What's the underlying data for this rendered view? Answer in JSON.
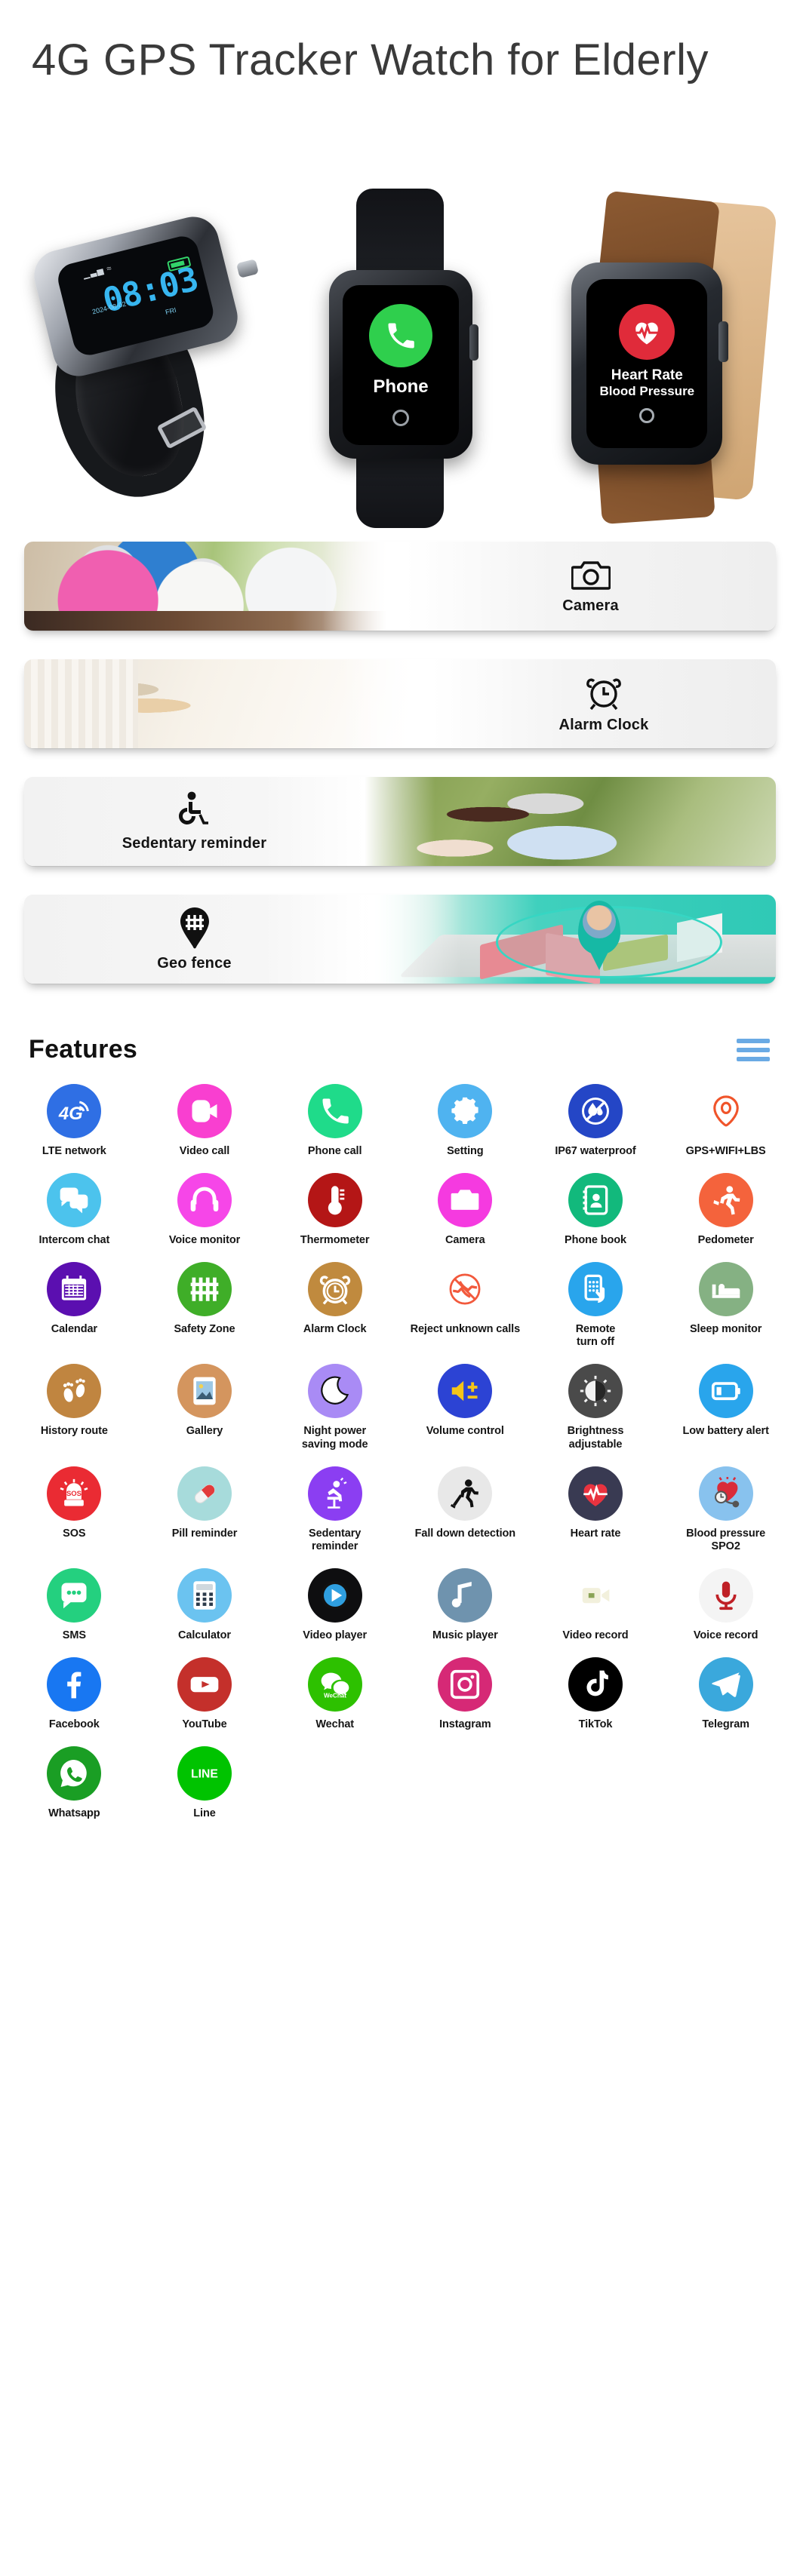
{
  "hero": {
    "title": "4G GPS Tracker Watch for Elderly",
    "watch1": {
      "time": "08:03",
      "date": "2024-08-02",
      "day": "FRI",
      "signal_icon": "signal-bars-icon",
      "wifi_icon": "wifi-icon",
      "battery_icon": "battery-icon"
    },
    "watch2": {
      "label": "Phone",
      "icon": "phone-handset-icon"
    },
    "watch3": {
      "line1": "Heart Rate",
      "line2": "Blood Pressure",
      "icon": "heart-pulse-icon"
    }
  },
  "banners": [
    {
      "label": "Camera",
      "icon": "camera-icon",
      "photo": "elderly-group-photo",
      "photo_side": "left"
    },
    {
      "label": "Alarm Clock",
      "icon": "alarm-clock-icon",
      "photo": "sleeping-woman-photo",
      "photo_side": "left"
    },
    {
      "label": "Sedentary reminder",
      "icon": "wheelchair-icon",
      "photo": "couple-outdoors-photo",
      "photo_side": "right"
    },
    {
      "label": "Geo fence",
      "icon": "geo-fence-pin-icon",
      "photo": "geo-fence-map",
      "photo_side": "right"
    }
  ],
  "features": {
    "title": "Features",
    "menu_icon": "hamburger-menu-icon",
    "menu_color": "#6aaae4",
    "items": [
      {
        "label": "LTE network",
        "icon": "4g-signal-icon",
        "color": "#2f6fe4",
        "fill": "#ffffff"
      },
      {
        "label": "Video call",
        "icon": "video-call-icon",
        "color": "#f93fd0",
        "fill": "#ffffff"
      },
      {
        "label": "Phone call",
        "icon": "phone-call-icon",
        "color": "#1fdb8a",
        "fill": "#ffffff"
      },
      {
        "label": "Setting",
        "icon": "gear-icon",
        "color": "#4fb3f0",
        "fill": "#ffffff"
      },
      {
        "label": "IP67 waterproof",
        "icon": "waterproof-drop-icon",
        "color": "#2446c6",
        "fill": "#ffffff"
      },
      {
        "label": "GPS+WIFI+LBS",
        "icon": "location-pin-icon",
        "color": "#ffffff",
        "fill": "#f0542a"
      },
      {
        "label": "Intercom chat",
        "icon": "chat-bubbles-icon",
        "color": "#4cc3ed",
        "fill": "#ffffff"
      },
      {
        "label": "Voice monitor",
        "icon": "headphones-icon",
        "color": "#f646e8",
        "fill": "#ffffff"
      },
      {
        "label": "Thermometer",
        "icon": "thermometer-icon",
        "color": "#b41616",
        "fill": "#ffffff"
      },
      {
        "label": "Camera",
        "icon": "camera-icon",
        "color": "#f53ae0",
        "fill": "#ffffff"
      },
      {
        "label": "Phone book",
        "icon": "phone-book-icon",
        "color": "#12b97c",
        "fill": "#ffffff"
      },
      {
        "label": "Pedometer",
        "icon": "running-person-icon",
        "color": "#f4633c",
        "fill": "#ffffff"
      },
      {
        "label": "Calendar",
        "icon": "calendar-icon",
        "color": "#5b0fb0",
        "fill": "#ffffff"
      },
      {
        "label": "Safety Zone",
        "icon": "fence-icon",
        "color": "#3fae28",
        "fill": "#ffffff"
      },
      {
        "label": "Alarm Clock",
        "icon": "alarm-clock-icon",
        "color": "#c08a3e",
        "fill": "#ffffff"
      },
      {
        "label": "Reject unknown calls",
        "icon": "reject-call-icon",
        "color": "#ffffff",
        "fill": "#f2593c"
      },
      {
        "label": "Remote\nturn off",
        "icon": "remote-hand-phone-icon",
        "color": "#29a5ec",
        "fill": "#ffffff"
      },
      {
        "label": "Sleep monitor",
        "icon": "bed-icon",
        "color": "#85b183",
        "fill": "#ffffff"
      },
      {
        "label": "History route",
        "icon": "footprints-icon",
        "color": "#c08540",
        "fill": "#ffffff"
      },
      {
        "label": "Gallery",
        "icon": "gallery-image-icon",
        "color": "#d4955e",
        "fill": "#ffffff"
      },
      {
        "label": "Night power\nsaving mode",
        "icon": "crescent-moon-icon",
        "color": "#a98bf5",
        "fill": "#ffffff"
      },
      {
        "label": "Volume control",
        "icon": "volume-plus-minus-icon",
        "color": "#2c43d4",
        "fill": "#f5c518"
      },
      {
        "label": "Brightness\nadjustable",
        "icon": "brightness-icon",
        "color": "#4a4a4a",
        "fill": "#f2f2f2"
      },
      {
        "label": "Low battery alert",
        "icon": "battery-low-icon",
        "color": "#29a5ec",
        "fill": "#ffffff"
      },
      {
        "label": "SOS",
        "icon": "sos-siren-icon",
        "color": "#ea2b33",
        "fill": "#ffffff"
      },
      {
        "label": "Pill reminder",
        "icon": "pill-capsule-icon",
        "color": "#a7dbdb",
        "fill": "#e23b3b"
      },
      {
        "label": "Sedentary\nreminder",
        "icon": "sitting-person-icon",
        "color": "#8b3ef2",
        "fill": "#ffffff"
      },
      {
        "label": "Fall down detection",
        "icon": "falling-person-icon",
        "color": "#e8e8e8",
        "fill": "#111111"
      },
      {
        "label": "Heart rate",
        "icon": "heart-pulse-icon",
        "color": "#393a52",
        "fill": "#e8333f"
      },
      {
        "label": "Blood pressure\nSPO2",
        "icon": "blood-pressure-icon",
        "color": "#88c2ee",
        "fill": "#d92b39"
      },
      {
        "label": "SMS",
        "icon": "sms-bubble-icon",
        "color": "#24d07f",
        "fill": "#ffffff"
      },
      {
        "label": "Calculator",
        "icon": "calculator-icon",
        "color": "#6bc3f0",
        "fill": "#ffffff"
      },
      {
        "label": "Video player",
        "icon": "play-button-icon",
        "color": "#0e0e10",
        "fill": "#2f9fe0"
      },
      {
        "label": "Music player",
        "icon": "music-note-icon",
        "color": "#6f93ae",
        "fill": "#ffffff"
      },
      {
        "label": "Video record",
        "icon": "video-camera-icon",
        "color": "#8ba košt",
        "fill": "#f2f0dc"
      },
      {
        "label": "Voice record",
        "icon": "microphone-icon",
        "color": "#f4f4f4",
        "fill": "#bf2026"
      },
      {
        "label": "Facebook",
        "icon": "facebook-icon",
        "color": "#1877f2",
        "fill": "#ffffff"
      },
      {
        "label": "YouTube",
        "icon": "youtube-icon",
        "color": "#c4302b",
        "fill": "#ffffff"
      },
      {
        "label": "Wechat",
        "icon": "wechat-icon",
        "color": "#2dc100",
        "fill": "#ffffff"
      },
      {
        "label": "Instagram",
        "icon": "instagram-icon",
        "color": "#d62976",
        "fill": "#ffffff"
      },
      {
        "label": "TikTok",
        "icon": "tiktok-icon",
        "color": "#000000",
        "fill": "#ffffff"
      },
      {
        "label": "Telegram",
        "icon": "telegram-icon",
        "color": "#3aa8dc",
        "fill": "#ffffff"
      },
      {
        "label": "Whatsapp",
        "icon": "whatsapp-icon",
        "color": "#1a9e24",
        "fill": "#ffffff"
      },
      {
        "label": "Line",
        "icon": "line-icon",
        "color": "#00c300",
        "fill": "#ffffff"
      }
    ]
  }
}
